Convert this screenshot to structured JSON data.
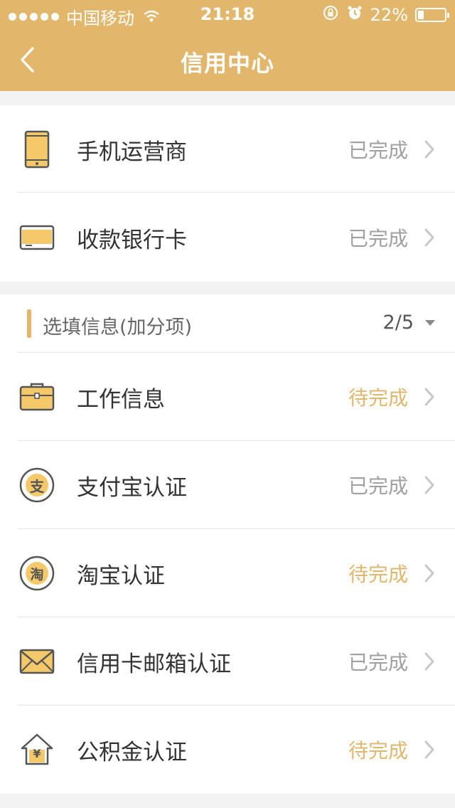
{
  "status_bar": {
    "carrier": "中国移动",
    "time": "21:18",
    "battery": "22%",
    "battery_level": 0.22
  },
  "header": {
    "title": "信用中心",
    "back_icon": "chevron-left-icon"
  },
  "colors": {
    "accent": "#e2b76c",
    "done": "#a0a0a0",
    "pending": "#e2b76c"
  },
  "required_items": [
    {
      "label": "手机运营商",
      "status": "已完成",
      "state": "done",
      "icon": "phone-icon"
    },
    {
      "label": "收款银行卡",
      "status": "已完成",
      "state": "done",
      "icon": "bank-card-icon"
    }
  ],
  "optional_section": {
    "title": "选填信息(加分项)",
    "count": "2/5"
  },
  "optional_items": [
    {
      "label": "工作信息",
      "status": "待完成",
      "state": "pending",
      "icon": "briefcase-icon"
    },
    {
      "label": "支付宝认证",
      "status": "已完成",
      "state": "done",
      "icon": "alipay-icon",
      "glyph": "支"
    },
    {
      "label": "淘宝认证",
      "status": "待完成",
      "state": "pending",
      "icon": "taobao-icon",
      "glyph": "淘"
    },
    {
      "label": "信用卡邮箱认证",
      "status": "已完成",
      "state": "done",
      "icon": "mail-icon"
    },
    {
      "label": "公积金认证",
      "status": "待完成",
      "state": "pending",
      "icon": "housing-fund-icon",
      "glyph": "¥"
    }
  ]
}
